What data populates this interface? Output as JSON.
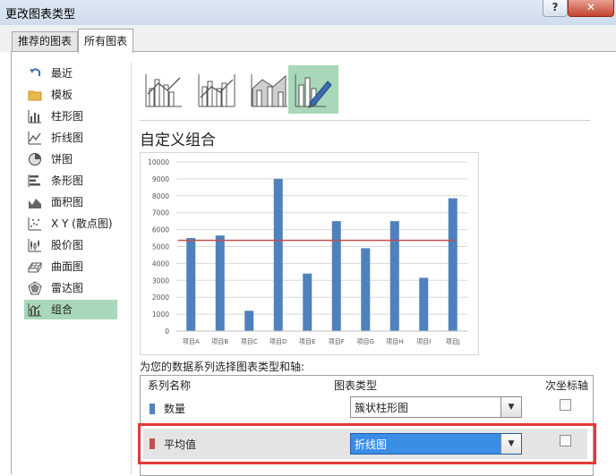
{
  "window": {
    "title": "更改图表类型",
    "help_label": "?",
    "close_label": "✕"
  },
  "tabs": [
    {
      "label": "推荐的图表",
      "active": false
    },
    {
      "label": "所有图表",
      "active": true
    }
  ],
  "categories": [
    {
      "label": "最近",
      "icon": "undo-icon"
    },
    {
      "label": "模板",
      "icon": "folder-icon"
    },
    {
      "label": "柱形图",
      "icon": "column-chart-icon"
    },
    {
      "label": "折线图",
      "icon": "line-chart-icon"
    },
    {
      "label": "饼图",
      "icon": "pie-chart-icon"
    },
    {
      "label": "条形图",
      "icon": "bar-chart-icon"
    },
    {
      "label": "面积图",
      "icon": "area-chart-icon"
    },
    {
      "label": "X Y (散点图)",
      "icon": "scatter-chart-icon"
    },
    {
      "label": "股价图",
      "icon": "stock-chart-icon"
    },
    {
      "label": "曲面图",
      "icon": "surface-chart-icon"
    },
    {
      "label": "雷达图",
      "icon": "radar-chart-icon"
    },
    {
      "label": "组合",
      "icon": "combo-chart-icon",
      "selected": true
    }
  ],
  "combo_section": {
    "title": "自定义组合"
  },
  "chart_data": {
    "type": "bar",
    "categories": [
      "项目A",
      "项目B",
      "项目C",
      "项目D",
      "项目E",
      "项目F",
      "项目G",
      "项目H",
      "项目I",
      "项目J"
    ],
    "series": [
      {
        "values": [
          5500,
          5650,
          1200,
          9000,
          3400,
          6500,
          4900,
          6500,
          3150,
          7850
        ],
        "type": "bar",
        "color": "#4f81bd"
      },
      {
        "values": [
          5365,
          5365,
          5365,
          5365,
          5365,
          5365,
          5365,
          5365,
          5365,
          5365
        ],
        "type": "line",
        "color": "#c0504d"
      }
    ],
    "yticks": [
      "0",
      "1000",
      "2000",
      "3000",
      "4000",
      "5000",
      "6000",
      "7000",
      "8000",
      "9000",
      "10000"
    ],
    "ylim": [
      0,
      10000
    ],
    "grid": true
  },
  "series_panel": {
    "prompt": "为您的数据系列选择图表类型和轴:",
    "headers": {
      "name": "系列名称",
      "type": "图表类型",
      "secondary": "次坐标轴"
    },
    "rows": [
      {
        "name": "数量",
        "color": "#4f81bd",
        "chart_type": "簇状柱形图",
        "secondary": false
      },
      {
        "name": "平均值",
        "color": "#c0504d",
        "chart_type": "折线图",
        "secondary": false,
        "active": true
      }
    ]
  }
}
